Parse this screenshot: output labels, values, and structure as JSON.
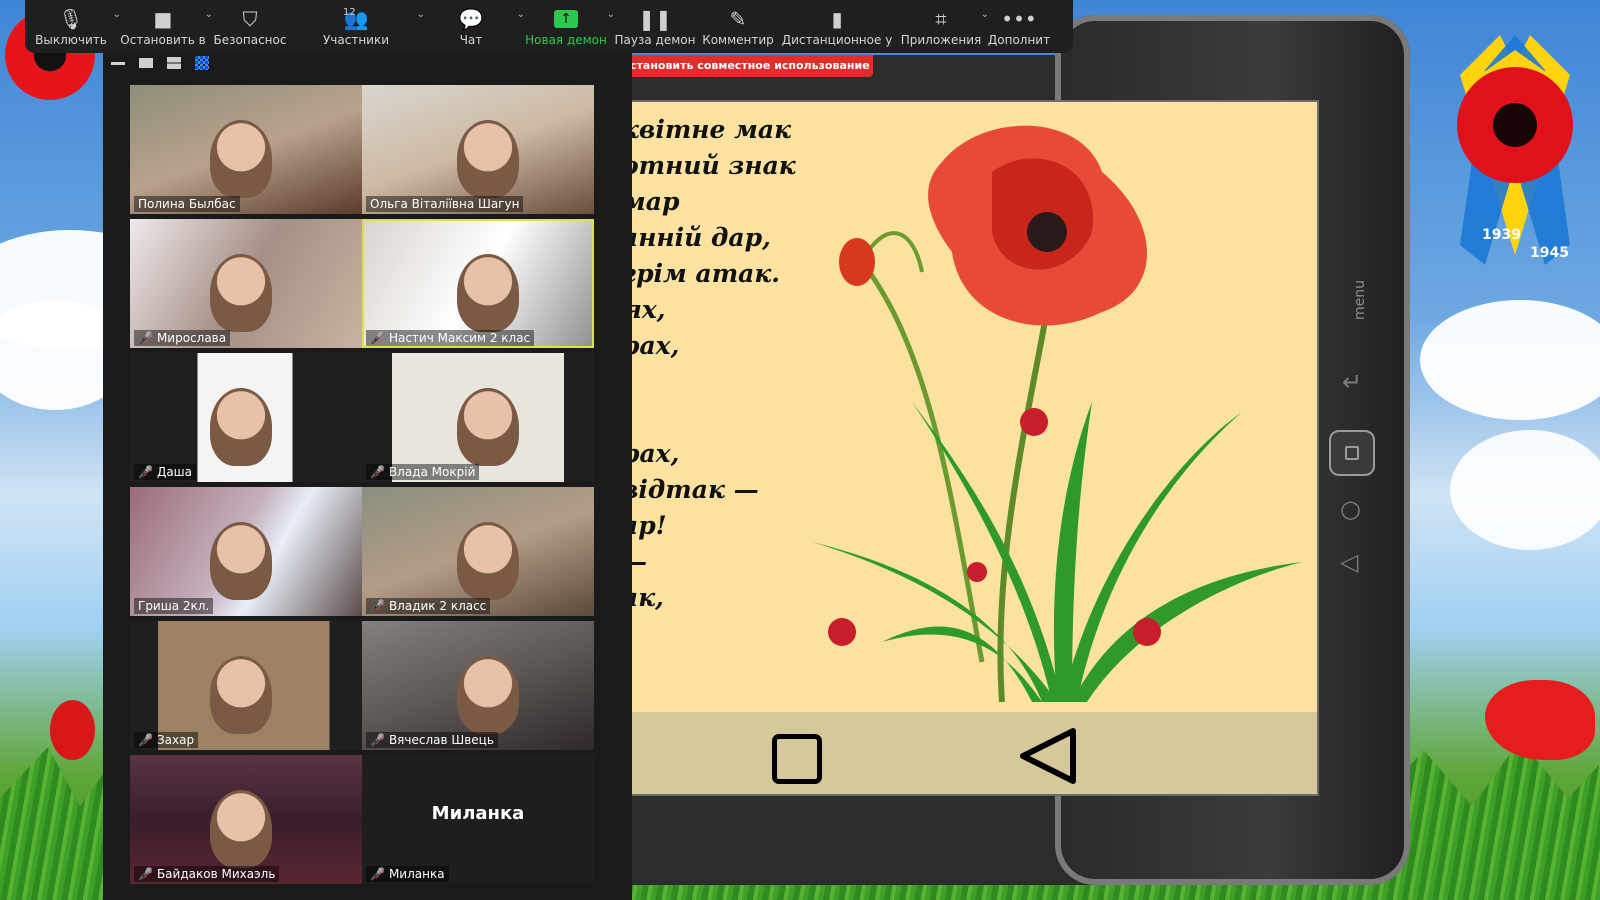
{
  "toolbar": {
    "items": [
      {
        "label": "Выключить",
        "icon": "microphone-icon",
        "caret": "⌄"
      },
      {
        "label": "Остановить в",
        "icon": "video-camera-icon",
        "caret": "⌄"
      },
      {
        "label": "Безопаснос",
        "icon": "shield-icon"
      },
      {
        "label": "Участники",
        "icon": "participants-icon",
        "caret": "⌄",
        "count": "12"
      },
      {
        "label": "Чат",
        "icon": "chat-icon",
        "caret": "⌄"
      },
      {
        "label": "Новая демон",
        "icon": "share-screen-icon",
        "caret": "⌄"
      },
      {
        "label": "Пауза демон",
        "icon": "pause-icon"
      },
      {
        "label": "Комментир",
        "icon": "pencil-icon"
      },
      {
        "label": "Дистанционное у",
        "icon": "mouse-icon"
      },
      {
        "label": "Приложения",
        "icon": "apps-icon",
        "caret": "⌄"
      },
      {
        "label": "Дополнит",
        "icon": "more-icon"
      }
    ]
  },
  "stop_share_label": "становить совместное использование",
  "participants": [
    {
      "name": "Полина Былбас",
      "muted": false
    },
    {
      "name": "Ольга Віталіївна Шагун",
      "muted": false
    },
    {
      "name": "Мирослава",
      "muted": true
    },
    {
      "name": "Настич Максим 2 клас",
      "muted": true,
      "active": true
    },
    {
      "name": "Даша",
      "muted": true
    },
    {
      "name": "Влада Мокрій",
      "muted": true
    },
    {
      "name": "Гриша 2кл.",
      "muted": false
    },
    {
      "name": "Владик 2 класс",
      "muted": true
    },
    {
      "name": "Захар",
      "muted": true
    },
    {
      "name": "Вячеслав Швець",
      "muted": true
    },
    {
      "name": "Байдаков Михаэль",
      "muted": true
    },
    {
      "name": "Миланка",
      "muted": true,
      "no_video": true,
      "display_name": "Миланка"
    }
  ],
  "poem_lines": [
    "квітне мак",
    "отний знак",
    "мар",
    "анній дар,",
    "грім атак.",
    "ях,",
    "рах,",
    "",
    "",
    "рах,",
    "відтак —",
    "ар!",
    "—",
    "ак,",
    "."
  ],
  "tablet": {
    "menu_label": "menu"
  },
  "ribbon": {
    "year_start": "1939",
    "year_end": "1945"
  },
  "colors": {
    "slide_bg": "#fbe2a0",
    "toolbar_bg": "#1f1f1f",
    "share_green": "#2ec84e",
    "stop_red": "#e02e2a",
    "active_border": "#d8e34a"
  }
}
